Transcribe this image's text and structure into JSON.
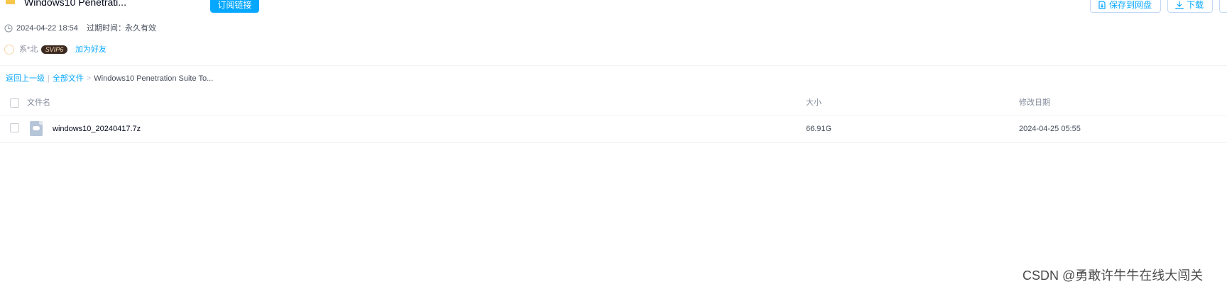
{
  "header": {
    "title": "Windows10 Penetrati...",
    "subscribe_label": "订阅链接",
    "save_label": "保存到网盘",
    "download_label": "下载"
  },
  "meta": {
    "created_time": "2024-04-22 18:54",
    "expire_label": "过期时间：",
    "expire_value": "永久有效"
  },
  "sharer": {
    "name": "系*北",
    "vip_badge": "SVIP6",
    "add_friend_label": "加为好友"
  },
  "breadcrumb": {
    "back_label": "返回上一级",
    "separator": "|",
    "all_files_label": "全部文件",
    "arrow": ">",
    "current": "Windows10 Penetration Suite To..."
  },
  "table": {
    "columns": [
      "文件名",
      "大小",
      "修改日期"
    ],
    "rows": [
      {
        "name": "windows10_20240417.7z",
        "size": "66.91G",
        "modified": "2024-04-25 05:55"
      }
    ]
  },
  "watermark": "CSDN @勇敢许牛牛在线大闯关",
  "icons": {
    "folder": "folder-icon",
    "clock": "clock-icon",
    "save": "save-icon",
    "download": "download-icon",
    "file": "archive-file-icon"
  },
  "colors": {
    "accent": "#06a7ff",
    "folder": "#f7c64a",
    "vip_badge_bg": "#3b2a22",
    "vip_badge_text": "#f8d9ae"
  }
}
